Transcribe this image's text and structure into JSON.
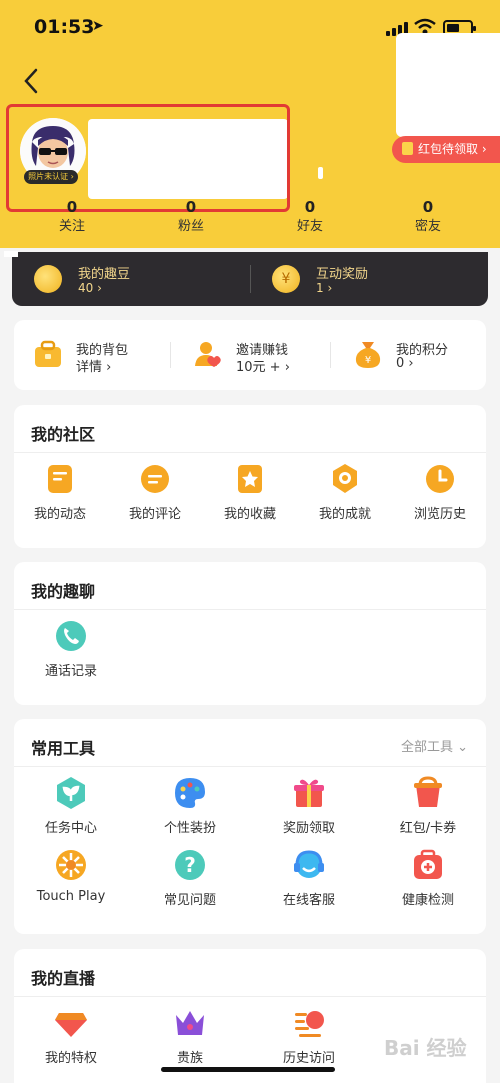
{
  "status_bar": {
    "time": "01:53"
  },
  "header": {
    "redpacket_label": "红包待领取 ›",
    "avatar_badge": "照片未认证 ›",
    "stats": [
      {
        "num": "0",
        "label": "关注"
      },
      {
        "num": "0",
        "label": "粉丝"
      },
      {
        "num": "0",
        "label": "好友"
      },
      {
        "num": "0",
        "label": "密友"
      }
    ]
  },
  "dark_bar": {
    "left_title": "我的趣豆",
    "left_value": "40 ›",
    "right_title": "互动奖励",
    "right_value": "1 ›"
  },
  "wallet": [
    {
      "title": "我的背包",
      "sub": "详情 ›"
    },
    {
      "title": "邀请赚钱",
      "sub": "10元 + ›"
    },
    {
      "title": "我的积分",
      "sub": "0 ›"
    }
  ],
  "community": {
    "title": "我的社区",
    "items": [
      "我的动态",
      "我的评论",
      "我的收藏",
      "我的成就",
      "浏览历史"
    ]
  },
  "chat": {
    "title": "我的趣聊",
    "items": [
      "通话记录"
    ]
  },
  "tools": {
    "title": "常用工具",
    "all_link": "全部工具 ⌄",
    "items": [
      "任务中心",
      "个性装扮",
      "奖励领取",
      "红包/卡券",
      "Touch Play",
      "常见问题",
      "在线客服",
      "健康检测"
    ]
  },
  "live": {
    "title": "我的直播",
    "items": [
      "我的特权",
      "贵族",
      "历史访问"
    ]
  },
  "watermark": "Bai 经验"
}
